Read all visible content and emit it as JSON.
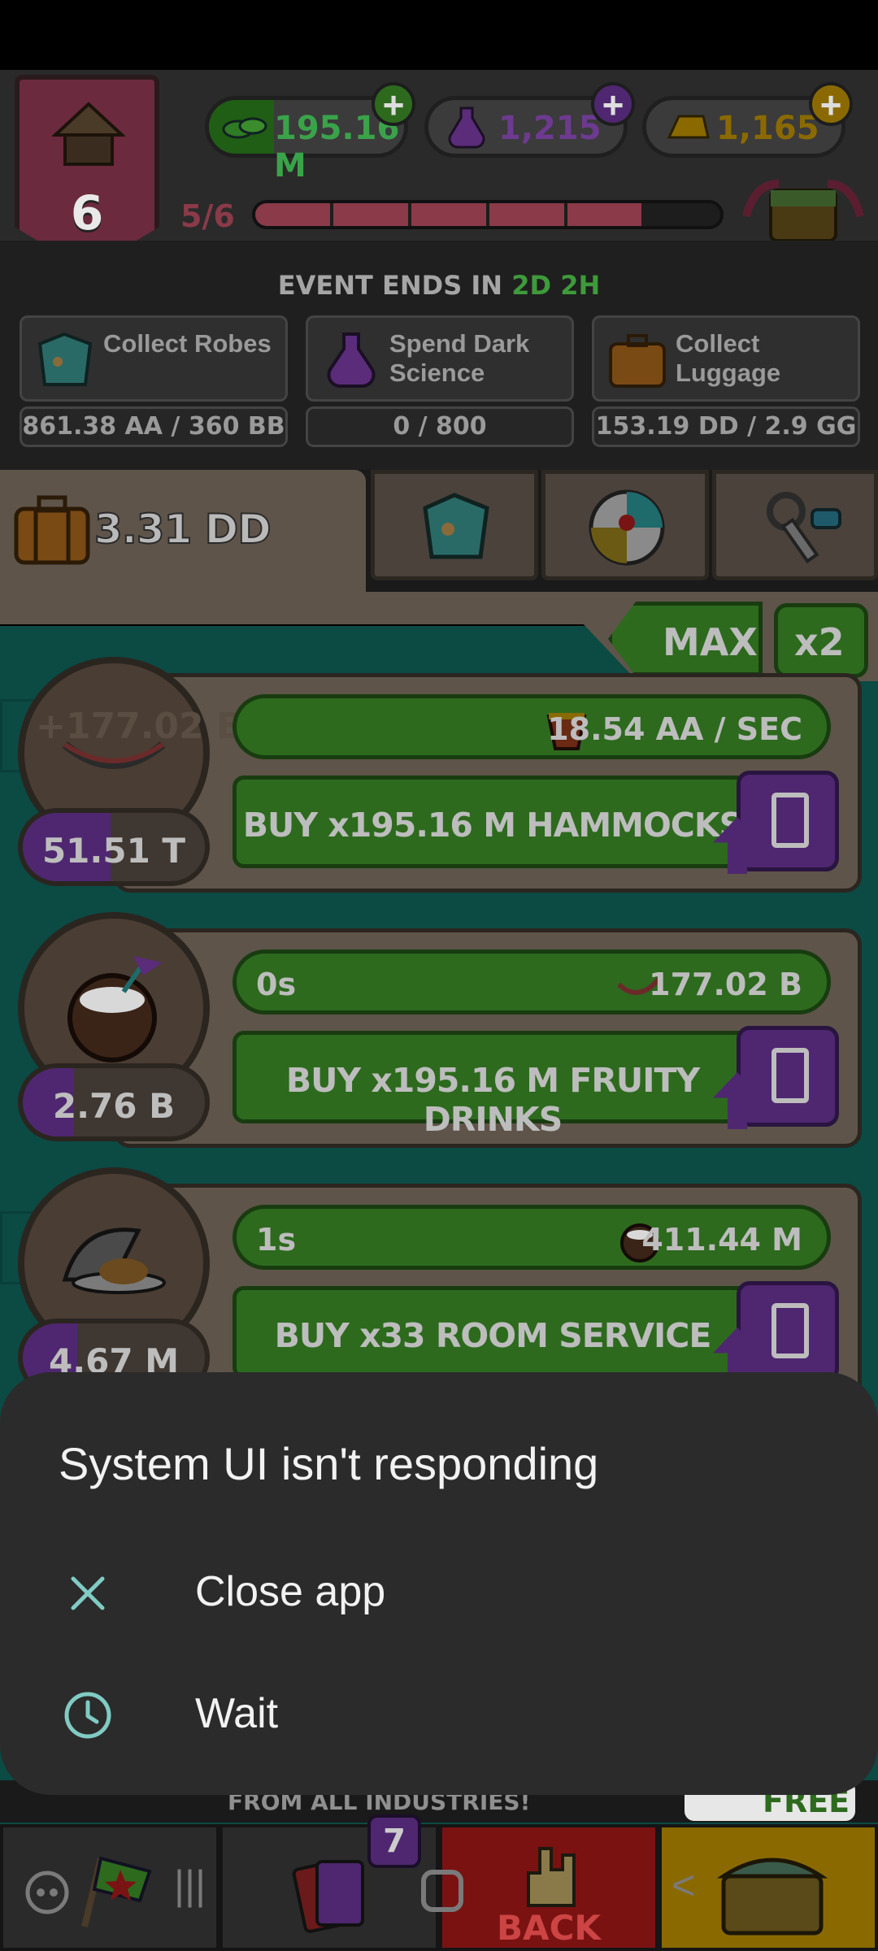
{
  "game": {
    "level": "6",
    "currencies": {
      "cash": "195.16 M",
      "dark_science": "1,215",
      "gold": "1,165"
    },
    "level_progress": {
      "label": "5/6",
      "fraction": 0.83
    },
    "event": {
      "ends_label": "EVENT ENDS IN",
      "days": "2D",
      "hours": "2H",
      "tasks": [
        {
          "label": "Collect Robes",
          "progress": "861.38 AA / 360 BB"
        },
        {
          "label": "Spend Dark Science",
          "progress": "0 / 800"
        },
        {
          "label": "Collect Luggage",
          "progress": "153.19 DD / 2.9 GG"
        }
      ]
    },
    "luggage_amount": "3.31 DD",
    "buy_mode": "MAX",
    "multiplier": "x2",
    "industries": [
      {
        "ghost_text": "+177.02 B",
        "count": "51.51 T",
        "count_fraction": 0.48,
        "timer": "",
        "rate": "18.54 AA / SEC",
        "buy_label": "BUY x195.16 M HAMMOCKS"
      },
      {
        "ghost_text": "",
        "count": "2.76 B",
        "count_fraction": 0.28,
        "timer": "0s",
        "rate": "177.02 B",
        "buy_label": "BUY x195.16 M FRUITY DRINKS"
      },
      {
        "ghost_text": "",
        "count": "4.67 M",
        "count_fraction": 0.3,
        "timer": "1s",
        "rate": "411.44 M",
        "buy_label": "BUY x33 ROOM SERVICE"
      }
    ],
    "ticker": "FROM ALL INDUSTRIES!",
    "free_label": "FREE",
    "nav": {
      "cards_badge": "7",
      "back_label": "BACK"
    }
  },
  "dialog": {
    "title": "System UI isn't responding",
    "options": [
      {
        "label": "Close app",
        "icon": "close-icon"
      },
      {
        "label": "Wait",
        "icon": "clock-icon"
      }
    ],
    "accent": "#80cbc4"
  }
}
